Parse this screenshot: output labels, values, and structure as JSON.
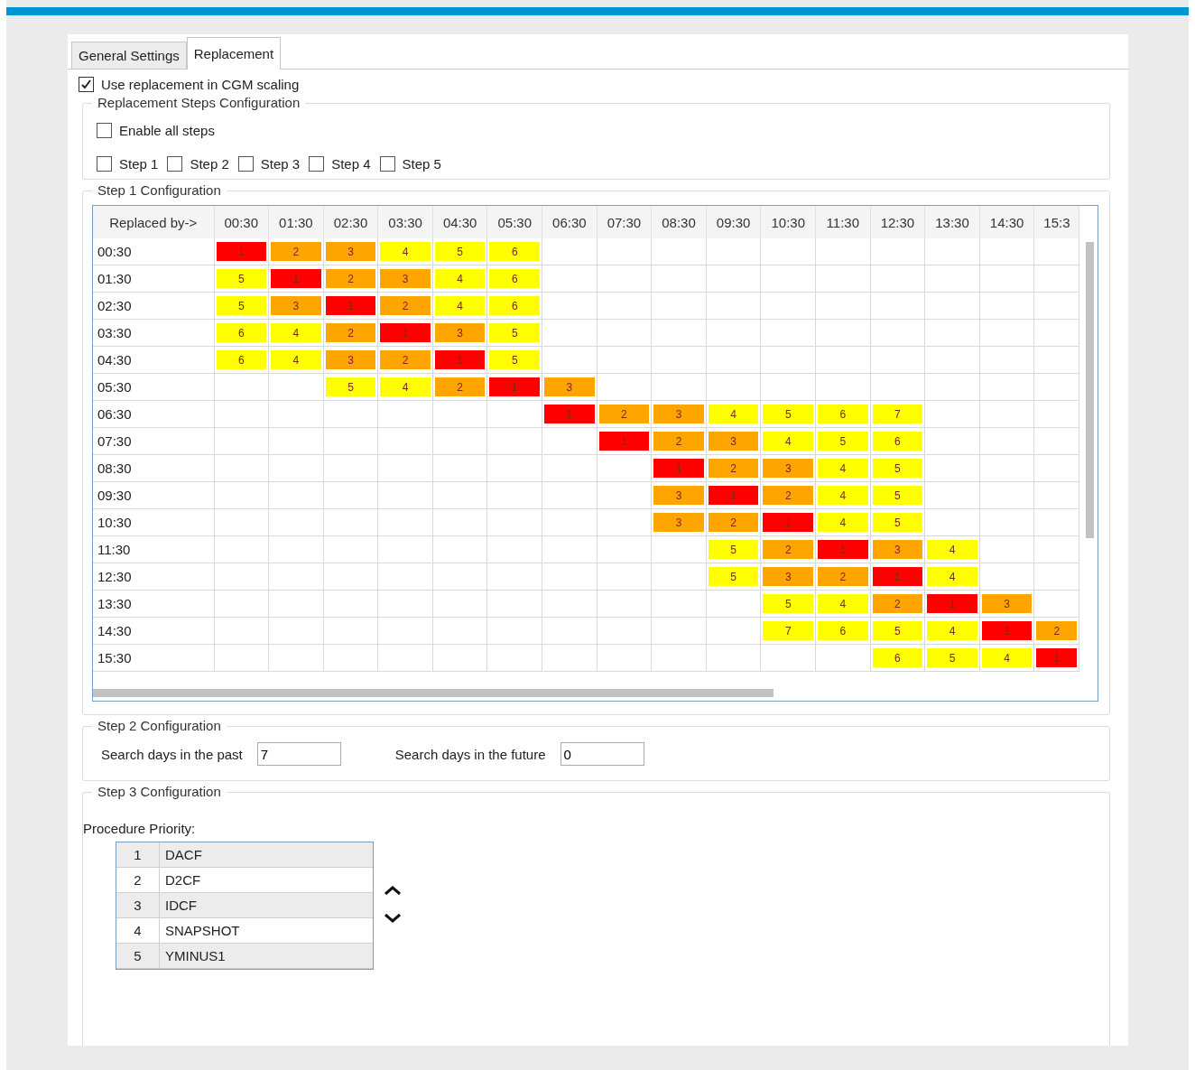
{
  "tabs": [
    {
      "label": "General Settings",
      "selected": false
    },
    {
      "label": "Replacement",
      "selected": true
    }
  ],
  "use_replacement": {
    "label": "Use replacement in CGM scaling",
    "checked": true
  },
  "steps_config": {
    "title": "Replacement Steps Configuration",
    "enable_all": {
      "label": "Enable all steps",
      "checked": false
    },
    "steps": [
      {
        "label": "Step 1",
        "checked": false
      },
      {
        "label": "Step 2",
        "checked": false
      },
      {
        "label": "Step 3",
        "checked": false
      },
      {
        "label": "Step 4",
        "checked": false
      },
      {
        "label": "Step 5",
        "checked": false
      }
    ]
  },
  "step1": {
    "title": "Step 1 Configuration",
    "corner": "Replaced by->",
    "columns": [
      "00:30",
      "01:30",
      "02:30",
      "03:30",
      "04:30",
      "05:30",
      "06:30",
      "07:30",
      "08:30",
      "09:30",
      "10:30",
      "11:30",
      "12:30",
      "13:30",
      "14:30",
      "15:3"
    ],
    "rows": [
      {
        "time": "00:30",
        "cells": [
          {
            "value": "1",
            "color": "#ff0000"
          },
          {
            "value": "2",
            "color": "#ffa500"
          },
          {
            "value": "3",
            "color": "#ffa500"
          },
          {
            "value": "4",
            "color": "#ffff00"
          },
          {
            "value": "5",
            "color": "#ffff00"
          },
          {
            "value": "6",
            "color": "#ffff00"
          },
          null,
          null,
          null,
          null,
          null,
          null,
          null,
          null,
          null,
          null
        ]
      },
      {
        "time": "01:30",
        "cells": [
          {
            "value": "5",
            "color": "#ffff00"
          },
          {
            "value": "1",
            "color": "#ff0000"
          },
          {
            "value": "2",
            "color": "#ffa500"
          },
          {
            "value": "3",
            "color": "#ffa500"
          },
          {
            "value": "4",
            "color": "#ffff00"
          },
          {
            "value": "6",
            "color": "#ffff00"
          },
          null,
          null,
          null,
          null,
          null,
          null,
          null,
          null,
          null,
          null
        ]
      },
      {
        "time": "02:30",
        "cells": [
          {
            "value": "5",
            "color": "#ffff00"
          },
          {
            "value": "3",
            "color": "#ffa500"
          },
          {
            "value": "1",
            "color": "#ff0000"
          },
          {
            "value": "2",
            "color": "#ffa500"
          },
          {
            "value": "4",
            "color": "#ffff00"
          },
          {
            "value": "6",
            "color": "#ffff00"
          },
          null,
          null,
          null,
          null,
          null,
          null,
          null,
          null,
          null,
          null
        ]
      },
      {
        "time": "03:30",
        "cells": [
          {
            "value": "6",
            "color": "#ffff00"
          },
          {
            "value": "4",
            "color": "#ffff00"
          },
          {
            "value": "2",
            "color": "#ffa500"
          },
          {
            "value": "1",
            "color": "#ff0000"
          },
          {
            "value": "3",
            "color": "#ffa500"
          },
          {
            "value": "5",
            "color": "#ffff00"
          },
          null,
          null,
          null,
          null,
          null,
          null,
          null,
          null,
          null,
          null
        ]
      },
      {
        "time": "04:30",
        "cells": [
          {
            "value": "6",
            "color": "#ffff00"
          },
          {
            "value": "4",
            "color": "#ffff00"
          },
          {
            "value": "3",
            "color": "#ffa500"
          },
          {
            "value": "2",
            "color": "#ffa500"
          },
          {
            "value": "1",
            "color": "#ff0000"
          },
          {
            "value": "5",
            "color": "#ffff00"
          },
          null,
          null,
          null,
          null,
          null,
          null,
          null,
          null,
          null,
          null
        ]
      },
      {
        "time": "05:30",
        "cells": [
          null,
          null,
          {
            "value": "5",
            "color": "#ffff00"
          },
          {
            "value": "4",
            "color": "#ffff00"
          },
          {
            "value": "2",
            "color": "#ffa500"
          },
          {
            "value": "1",
            "color": "#ff0000"
          },
          {
            "value": "3",
            "color": "#ffa500"
          },
          null,
          null,
          null,
          null,
          null,
          null,
          null,
          null,
          null
        ]
      },
      {
        "time": "06:30",
        "cells": [
          null,
          null,
          null,
          null,
          null,
          null,
          {
            "value": "1",
            "color": "#ff0000"
          },
          {
            "value": "2",
            "color": "#ffa500"
          },
          {
            "value": "3",
            "color": "#ffa500"
          },
          {
            "value": "4",
            "color": "#ffff00"
          },
          {
            "value": "5",
            "color": "#ffff00"
          },
          {
            "value": "6",
            "color": "#ffff00"
          },
          {
            "value": "7",
            "color": "#ffff00"
          },
          null,
          null,
          null
        ]
      },
      {
        "time": "07:30",
        "cells": [
          null,
          null,
          null,
          null,
          null,
          null,
          null,
          {
            "value": "1",
            "color": "#ff0000"
          },
          {
            "value": "2",
            "color": "#ffa500"
          },
          {
            "value": "3",
            "color": "#ffa500"
          },
          {
            "value": "4",
            "color": "#ffff00"
          },
          {
            "value": "5",
            "color": "#ffff00"
          },
          {
            "value": "6",
            "color": "#ffff00"
          },
          null,
          null,
          null
        ]
      },
      {
        "time": "08:30",
        "cells": [
          null,
          null,
          null,
          null,
          null,
          null,
          null,
          null,
          {
            "value": "1",
            "color": "#ff0000"
          },
          {
            "value": "2",
            "color": "#ffa500"
          },
          {
            "value": "3",
            "color": "#ffa500"
          },
          {
            "value": "4",
            "color": "#ffff00"
          },
          {
            "value": "5",
            "color": "#ffff00"
          },
          null,
          null,
          null
        ]
      },
      {
        "time": "09:30",
        "cells": [
          null,
          null,
          null,
          null,
          null,
          null,
          null,
          null,
          {
            "value": "3",
            "color": "#ffa500"
          },
          {
            "value": "1",
            "color": "#ff0000"
          },
          {
            "value": "2",
            "color": "#ffa500"
          },
          {
            "value": "4",
            "color": "#ffff00"
          },
          {
            "value": "5",
            "color": "#ffff00"
          },
          null,
          null,
          null
        ]
      },
      {
        "time": "10:30",
        "cells": [
          null,
          null,
          null,
          null,
          null,
          null,
          null,
          null,
          {
            "value": "3",
            "color": "#ffa500"
          },
          {
            "value": "2",
            "color": "#ffa500"
          },
          {
            "value": "1",
            "color": "#ff0000"
          },
          {
            "value": "4",
            "color": "#ffff00"
          },
          {
            "value": "5",
            "color": "#ffff00"
          },
          null,
          null,
          null
        ]
      },
      {
        "time": "11:30",
        "cells": [
          null,
          null,
          null,
          null,
          null,
          null,
          null,
          null,
          null,
          {
            "value": "5",
            "color": "#ffff00"
          },
          {
            "value": "2",
            "color": "#ffa500"
          },
          {
            "value": "1",
            "color": "#ff0000"
          },
          {
            "value": "3",
            "color": "#ffa500"
          },
          {
            "value": "4",
            "color": "#ffff00"
          },
          null,
          null
        ]
      },
      {
        "time": "12:30",
        "cells": [
          null,
          null,
          null,
          null,
          null,
          null,
          null,
          null,
          null,
          {
            "value": "5",
            "color": "#ffff00"
          },
          {
            "value": "3",
            "color": "#ffa500"
          },
          {
            "value": "2",
            "color": "#ffa500"
          },
          {
            "value": "1",
            "color": "#ff0000"
          },
          {
            "value": "4",
            "color": "#ffff00"
          },
          null,
          null
        ]
      },
      {
        "time": "13:30",
        "cells": [
          null,
          null,
          null,
          null,
          null,
          null,
          null,
          null,
          null,
          null,
          {
            "value": "5",
            "color": "#ffff00"
          },
          {
            "value": "4",
            "color": "#ffff00"
          },
          {
            "value": "2",
            "color": "#ffa500"
          },
          {
            "value": "1",
            "color": "#ff0000"
          },
          {
            "value": "3",
            "color": "#ffa500"
          },
          null
        ]
      },
      {
        "time": "14:30",
        "cells": [
          null,
          null,
          null,
          null,
          null,
          null,
          null,
          null,
          null,
          null,
          {
            "value": "7",
            "color": "#ffff00"
          },
          {
            "value": "6",
            "color": "#ffff00"
          },
          {
            "value": "5",
            "color": "#ffff00"
          },
          {
            "value": "4",
            "color": "#ffff00"
          },
          {
            "value": "1",
            "color": "#ff0000"
          },
          {
            "value": "2",
            "color": "#ffa500"
          }
        ]
      },
      {
        "time": "15:30",
        "cells": [
          null,
          null,
          null,
          null,
          null,
          null,
          null,
          null,
          null,
          null,
          null,
          null,
          {
            "value": "6",
            "color": "#ffff00"
          },
          {
            "value": "5",
            "color": "#ffff00"
          },
          {
            "value": "4",
            "color": "#ffff00"
          },
          {
            "value": "1",
            "color": "#ff0000"
          }
        ]
      }
    ]
  },
  "step2": {
    "title": "Step 2 Configuration",
    "fields": [
      {
        "label": "Search days in the past",
        "value": "7"
      },
      {
        "label": "Search days in the future",
        "value": "0"
      }
    ]
  },
  "step3": {
    "title": "Step 3 Configuration",
    "list_label": "Procedure Priority:",
    "priorities": [
      {
        "rank": "1",
        "name": "DACF"
      },
      {
        "rank": "2",
        "name": "D2CF"
      },
      {
        "rank": "3",
        "name": "IDCF"
      },
      {
        "rank": "4",
        "name": "SNAPSHOT"
      },
      {
        "rank": "5",
        "name": "YMINUS1"
      }
    ]
  }
}
